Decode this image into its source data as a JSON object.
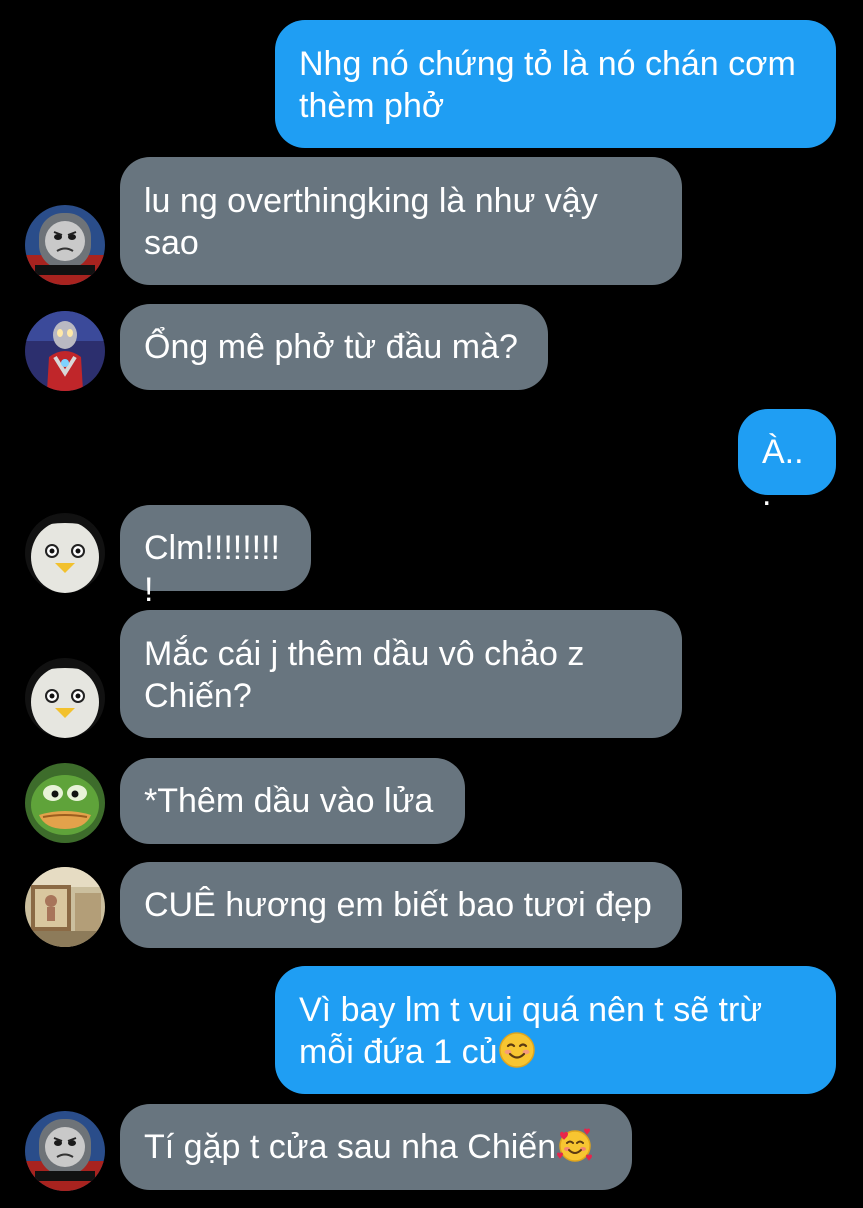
{
  "messages": [
    {
      "id": 1,
      "direction": "outgoing",
      "text": "Nhg nó chứng tỏ là nó chán cơm thèm phở"
    },
    {
      "id": 2,
      "direction": "incoming",
      "avatar": "train-face-avatar",
      "text": "lu ng overthingking là như vậy sao"
    },
    {
      "id": 3,
      "direction": "incoming",
      "avatar": "red-hero-avatar",
      "text": "Ổng mê phở từ đầu mà?"
    },
    {
      "id": 4,
      "direction": "outgoing",
      "text": "À..."
    },
    {
      "id": 5,
      "direction": "incoming",
      "avatar": "duck-face-avatar",
      "text": "Clm!!!!!!!!!"
    },
    {
      "id": 6,
      "direction": "incoming",
      "avatar": "duck-face-avatar",
      "text": "Mắc cái j thêm dầu vô chảo z Chiến?"
    },
    {
      "id": 7,
      "direction": "incoming",
      "avatar": "green-frog-avatar",
      "text": "*Thêm dầu vào lửa"
    },
    {
      "id": 8,
      "direction": "incoming",
      "avatar": "room-avatar",
      "text": "CUÊ hương em biết bao tươi đẹp"
    },
    {
      "id": 9,
      "direction": "outgoing",
      "text": "Vì bay lm t vui quá nên t sẽ trừ mỗi đứa 1 củ",
      "emoji": "smiling-face-emoji"
    },
    {
      "id": 10,
      "direction": "incoming",
      "avatar": "train-face-avatar",
      "text": "Tí gặp t cửa sau nha Chiến",
      "emoji": "smiling-face-with-hearts-emoji"
    }
  ],
  "colors": {
    "background": "#000000",
    "outgoing_bubble": "#1f9ef3",
    "incoming_bubble": "#68757f",
    "text": "#ffffff"
  }
}
